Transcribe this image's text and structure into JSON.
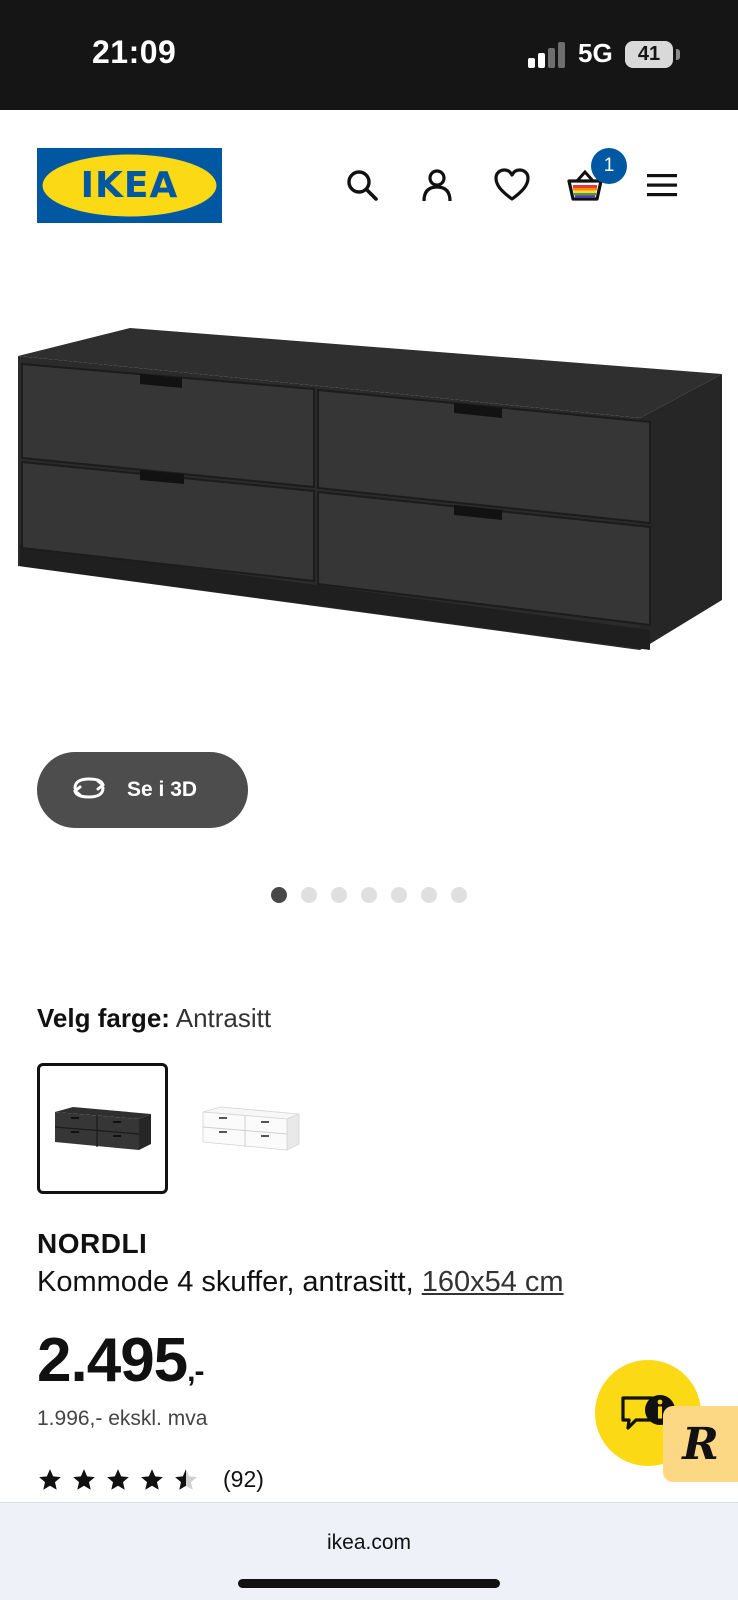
{
  "status_bar": {
    "time": "21:09",
    "network": "5G",
    "battery": "41"
  },
  "header": {
    "logo_text": "IKEA",
    "cart_count": "1",
    "icons": [
      "search-icon",
      "account-icon",
      "heart-icon",
      "cart-icon",
      "menu-icon"
    ]
  },
  "gallery": {
    "view_3d_label": "Se i 3D",
    "dot_count": 7,
    "active_dot": 0
  },
  "color_select": {
    "label": "Velg farge:",
    "value": "Antrasitt",
    "options": [
      "Antrasitt",
      "Hvit"
    ],
    "selected_index": 0
  },
  "product": {
    "name": "NORDLI",
    "description": "Kommode 4 skuffer, antrasitt, ",
    "size_link": "160x54 cm",
    "price": "2.495",
    "price_suffix": ",-",
    "price_ex_vat": "1.996,- ekskl. mva",
    "rating": 4.5,
    "review_count": "(92)"
  },
  "browser": {
    "url": "ikea.com"
  },
  "colors": {
    "ikea_blue": "#0058a3",
    "ikea_yellow": "#fbd914",
    "status_bar_bg": "#151515",
    "button_3d_bg": "#4d4d4d"
  }
}
